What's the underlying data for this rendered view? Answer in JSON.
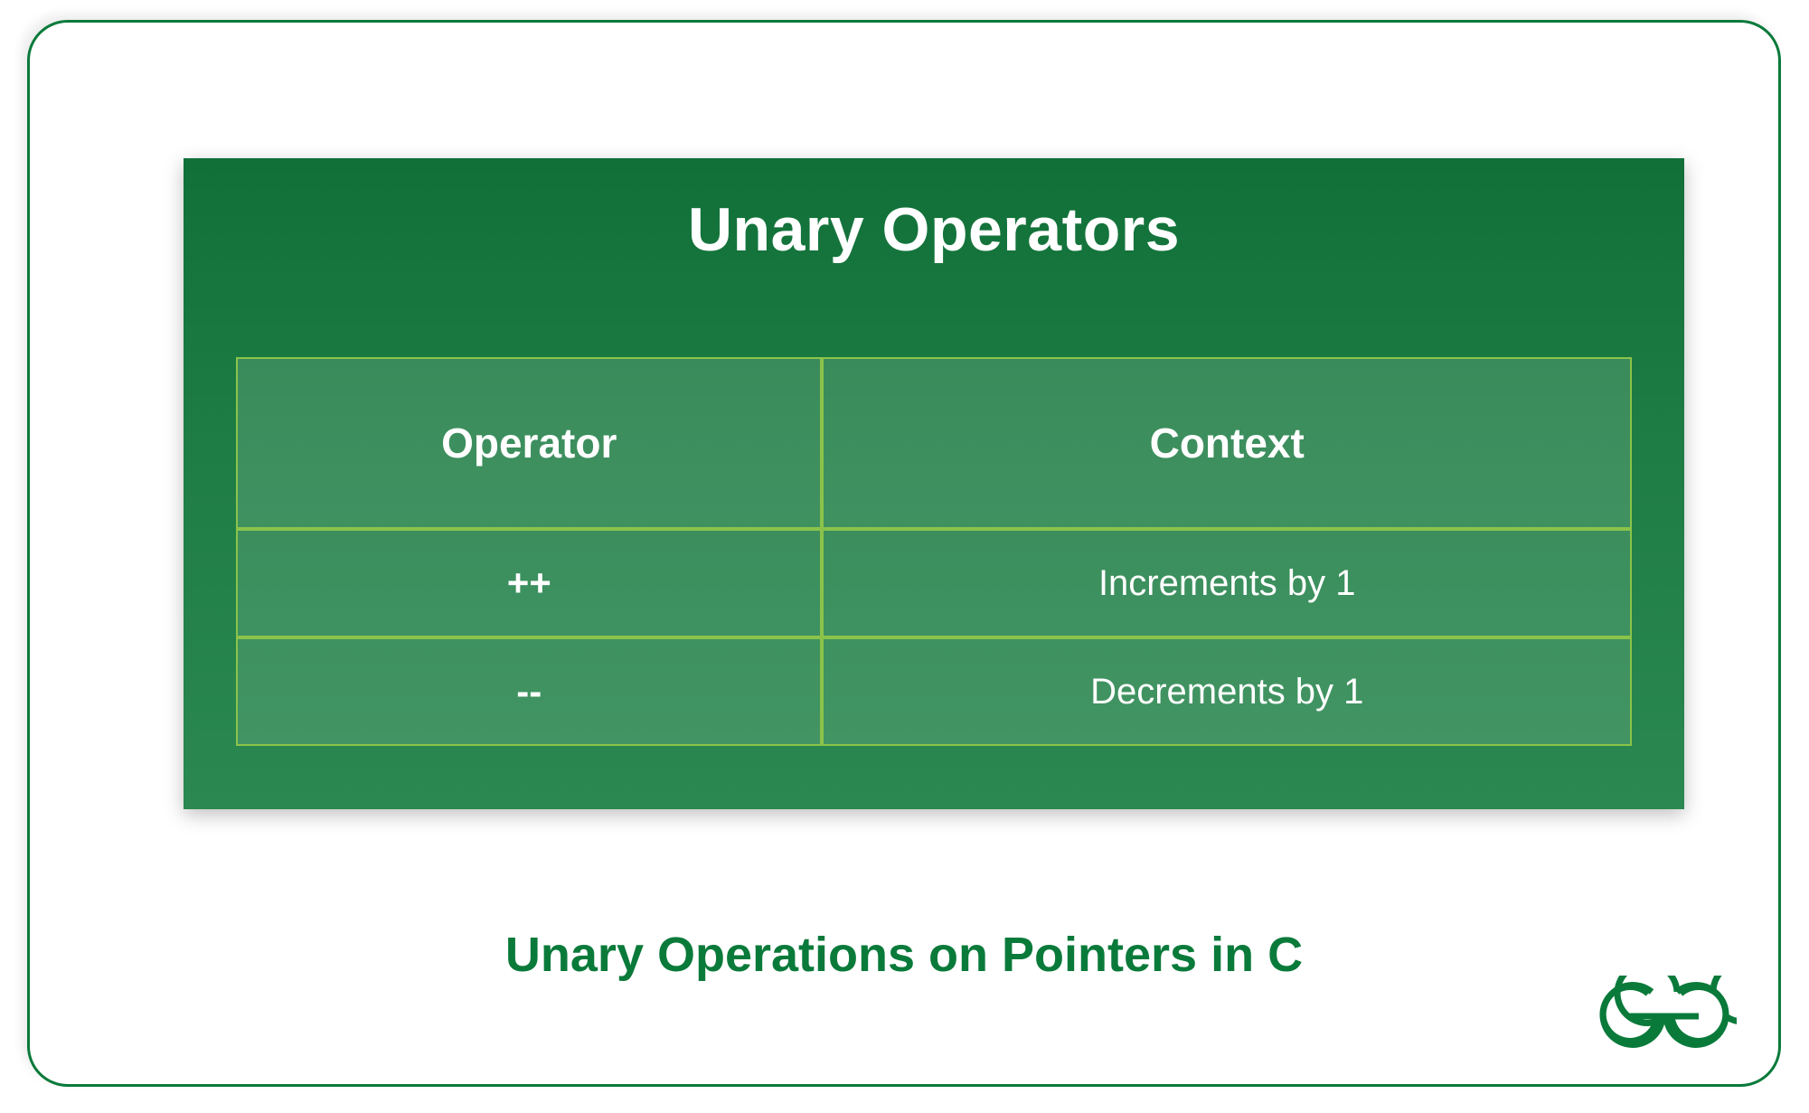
{
  "panel": {
    "title": "Unary Operators"
  },
  "table": {
    "headers": {
      "col0": "Operator",
      "col1": "Context"
    },
    "rows": [
      {
        "operator": "++",
        "context": "Increments by 1"
      },
      {
        "operator": "--",
        "context": "Decrements by 1"
      }
    ]
  },
  "caption": "Unary Operations on Pointers in C",
  "colors": {
    "accent_green": "#0a7a3a",
    "panel_green_top": "#107038",
    "panel_green_bottom": "#2a8850",
    "cell_border": "#8bc34a"
  }
}
